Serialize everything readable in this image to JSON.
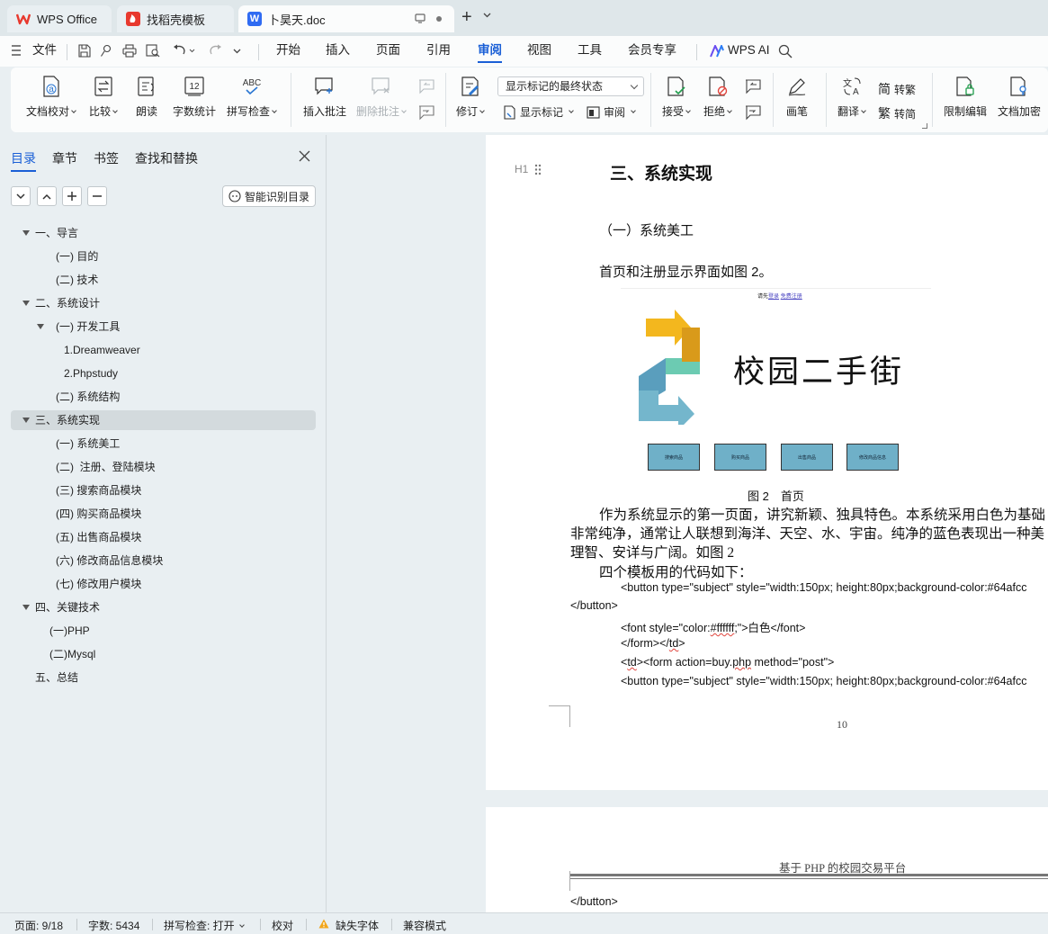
{
  "tabs": [
    {
      "label": "WPS Office"
    },
    {
      "label": "找稻壳模板"
    },
    {
      "label": "卜昊天.doc"
    }
  ],
  "menu": {
    "file": "文件",
    "items": [
      "开始",
      "插入",
      "页面",
      "引用",
      "审阅",
      "视图",
      "工具",
      "会员专享"
    ],
    "wps_ai": "WPS AI"
  },
  "ribbon": {
    "proofread": "文档校对",
    "compare": "比较",
    "read_aloud": "朗读",
    "word_count": "字数统计",
    "spell_check": "拼写检查",
    "insert_comment": "插入批注",
    "delete_comment": "删除批注",
    "track_changes": "修订",
    "markup_mode": "显示标记的最终状态",
    "show_markup": "显示标记",
    "reviewing": "审阅",
    "accept": "接受",
    "reject": "拒绝",
    "pen": "画笔",
    "translate": "翻译",
    "to_traditional": "转繁",
    "to_simplified": "转简",
    "restrict_edit": "限制编辑",
    "encrypt": "文档加密",
    "abc": "ABC",
    "count_icon_text": "12"
  },
  "nav": {
    "tabs": [
      "目录",
      "章节",
      "书签",
      "查找和替换"
    ],
    "smart_toc": "智能识别目录",
    "toc": [
      {
        "label": "一、导言"
      },
      {
        "label": "(一) 目的"
      },
      {
        "label": "(二) 技术"
      },
      {
        "label": "二、系统设计"
      },
      {
        "label": "(一) 开发工具"
      },
      {
        "label": "1.Dreamweaver"
      },
      {
        "label": "2.Phpstudy"
      },
      {
        "label": "(二) 系统结构"
      },
      {
        "label": "三、系统实现"
      },
      {
        "label": "(一) 系统美工"
      },
      {
        "label": "(二)  注册、登陆模块"
      },
      {
        "label": "(三) 搜索商品模块"
      },
      {
        "label": "(四) 购买商品模块"
      },
      {
        "label": "(五) 出售商品模块"
      },
      {
        "label": "(六) 修改商品信息模块"
      },
      {
        "label": "(七) 修改用户模块"
      },
      {
        "label": "四、关键技术"
      },
      {
        "label": "(一)PHP"
      },
      {
        "label": "(二)Mysql"
      },
      {
        "label": "五、总结"
      }
    ]
  },
  "doc": {
    "heading_marker": "H1",
    "heading": "三、系统实现",
    "subheading": "（一）系统美工",
    "para1": "首页和注册显示界面如图 2。",
    "figure": {
      "top_text_prefix": "请先",
      "login_link": "登录",
      "register_link": "免费注册",
      "logo_text": "校园二手街",
      "buttons": [
        "搜索商品",
        "购买商品",
        "出售商品",
        "修改商品信息"
      ]
    },
    "caption": "图 2　首页",
    "body_line1": "作为系统显示的第一页面，讲究新颖、独具特色。本系统采用白色为基础",
    "body_line2": "非常纯净，通常让人联想到海洋、天空、水、宇宙。纯净的蓝色表现出一种美",
    "body_line3": "理智、安详与广阔。如图 2",
    "code_intro": "四个模板用的代码如下：",
    "code1": "<button type=\"subject\" style=\"width:150px; height:80px;background-color:#64afcc",
    "code2": "</button>",
    "code3_pre": "<font style=\"color:",
    "code3_hex": "#ffffff",
    "code3_post": ";\">白色</font>",
    "code4_pre": "</form></",
    "code4_td": "td",
    "code4_post": ">",
    "code5_pre": "<",
    "code5_td": "td",
    "code5_mid": "><form action=buy.",
    "code5_php": "php",
    "code5_post": " method=\"post\">",
    "code6": "<button type=\"subject\" style=\"width:150px; height:80px;background-color:#64afcc",
    "page_number": "10",
    "header2": "基于 PHP 的校园交易平台",
    "page2_line": "</button>"
  },
  "status": {
    "page": "页面: 9/18",
    "words": "字数: 5434",
    "spell": "拼写检查: 打开",
    "proof": "校对",
    "missing_font": "缺失字体",
    "compat": "兼容模式"
  },
  "colors": {
    "accent": "#1a5fd6",
    "logo_text": "#4a9ec4",
    "figure_button": "#6fb0c8"
  }
}
